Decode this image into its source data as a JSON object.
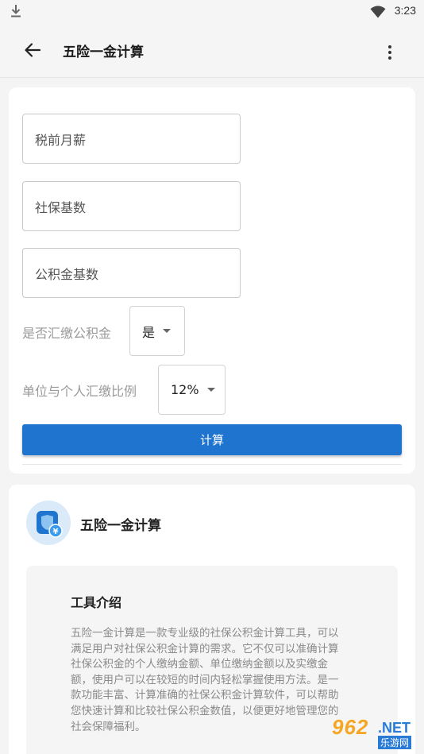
{
  "status_bar": {
    "time": "3:23"
  },
  "app_bar": {
    "title": "五险一金计算"
  },
  "form": {
    "salary_placeholder": "税前月薪",
    "social_base_placeholder": "社保基数",
    "fund_base_placeholder": "公积金基数",
    "pay_fund_label": "是否汇缴公积金",
    "pay_fund_value": "是",
    "ratio_label": "单位与个人汇缴比例",
    "ratio_value": "12%",
    "calc_button": "计算"
  },
  "tool": {
    "name": "五险一金计算",
    "intro_title": "工具介绍",
    "intro_text": "五险一金计算是一款专业级的社保公积金计算工具，可以满足用户对社保公积金计算的需求。它不仅可以准确计算社保公积金的个人缴纳金额、单位缴纳金额以及实缴金额，使用户可以在较短的时间内轻松掌握使用方法。是一款功能丰富、计算准确的社保公积金计算软件，可以帮助您快速计算和比较社保公积金数值，以便更好地管理您的社会保障福利。"
  },
  "watermark": {
    "number": "962",
    "suffix": ".NET",
    "cn": "乐游网"
  },
  "colors": {
    "primary": "#1f74d0",
    "icon_bg": "#dbeaf8"
  }
}
